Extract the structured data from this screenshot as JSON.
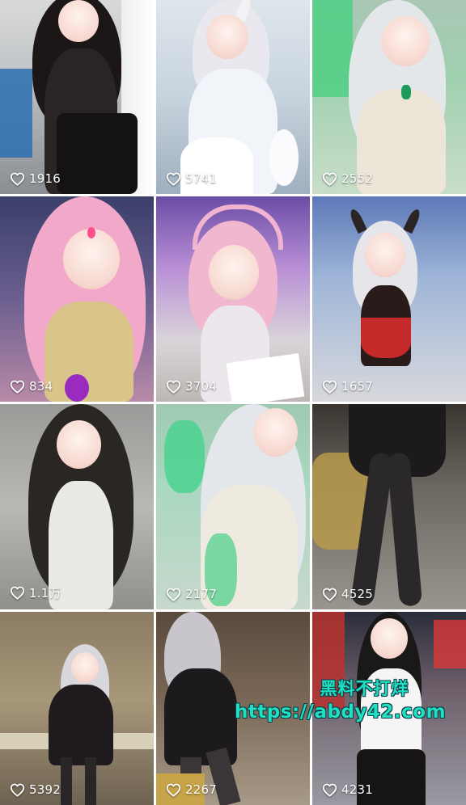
{
  "feed": {
    "tiles": [
      {
        "likes": "1916"
      },
      {
        "likes": "5741"
      },
      {
        "likes": "2552"
      },
      {
        "likes": "834"
      },
      {
        "likes": "3704"
      },
      {
        "likes": "1657"
      },
      {
        "likes": "1.1万"
      },
      {
        "likes": "2177"
      },
      {
        "likes": "4525"
      },
      {
        "likes": "5392"
      },
      {
        "likes": "2267"
      },
      {
        "likes": "4231"
      }
    ]
  },
  "watermark": {
    "line1": "黑料不打烊",
    "line2": "https://abdy42.com"
  },
  "colors": {
    "like_text": "#ffffff",
    "watermark_fill": "#1fe0c0",
    "watermark_outline": "#0b3b46"
  }
}
